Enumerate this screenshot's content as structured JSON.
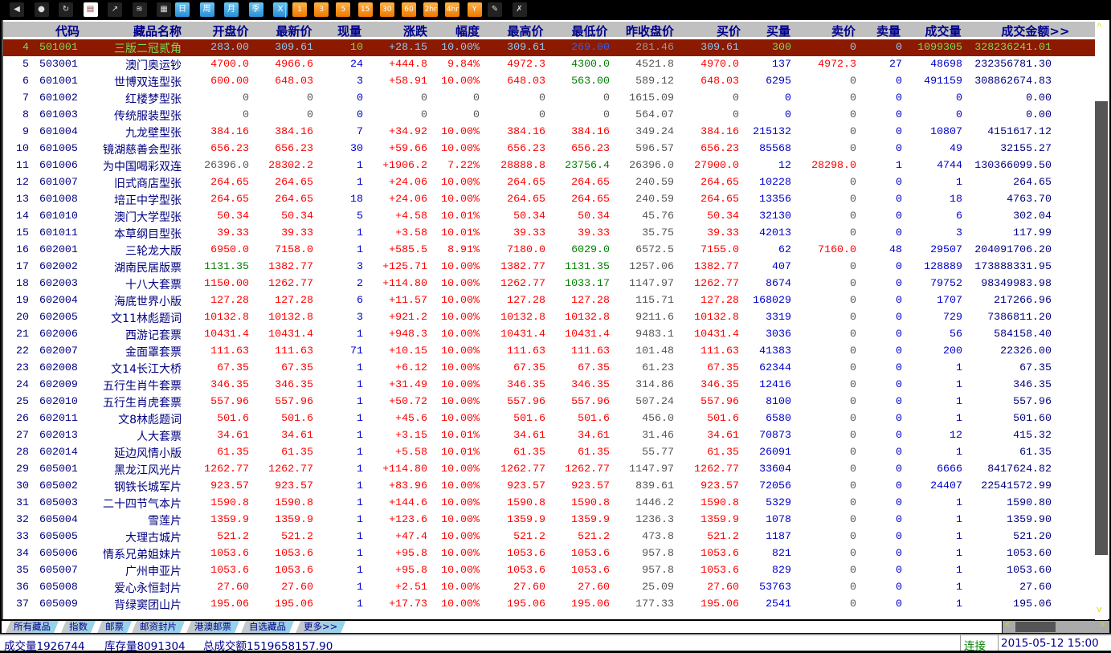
{
  "toolbar": {
    "icons": [
      "back-icon",
      "home-icon",
      "refresh-icon",
      "clipboard-icon",
      "trend-chart-icon",
      "multi-chart-icon",
      "table-icon"
    ],
    "period_buttons": [
      "日",
      "周",
      "月",
      "季",
      "X"
    ],
    "minute_buttons": [
      "1",
      "3",
      "5",
      "15",
      "30",
      "60",
      "2hr",
      "4hr",
      "Y"
    ],
    "tools": [
      "edit-icon",
      "draw-tools-icon"
    ]
  },
  "table": {
    "headers": [
      "代码",
      "藏品名称",
      "开盘价",
      "最新价",
      "现量",
      "涨跌",
      "幅度",
      "最高价",
      "最低价",
      "昨收盘价",
      "买价",
      "买量",
      "卖价",
      "卖量",
      "成交量",
      "成交金额>>"
    ],
    "selected_row": 0,
    "rows": [
      [
        "4",
        "501001",
        "三版二冠贰角",
        "283.00",
        "309.61",
        "10",
        "+28.15",
        "10.00%",
        "309.61",
        "269.00",
        "281.46",
        "309.61",
        "300",
        "0",
        "0",
        "1099305",
        "328236241.01"
      ],
      [
        "5",
        "503001",
        "澳门奥运钞",
        "4700.0",
        "4966.6",
        "24",
        "+444.8",
        "9.84%",
        "4972.3",
        "4300.0",
        "4521.8",
        "4970.0",
        "137",
        "4972.3",
        "27",
        "48698",
        "232356781.30"
      ],
      [
        "6",
        "601001",
        "世博双连型张",
        "600.00",
        "648.03",
        "3",
        "+58.91",
        "10.00%",
        "648.03",
        "563.00",
        "589.12",
        "648.03",
        "6295",
        "0",
        "0",
        "491159",
        "308862674.83"
      ],
      [
        "7",
        "601002",
        "红楼梦型张",
        "0",
        "0",
        "0",
        "0",
        "0",
        "0",
        "0",
        "1615.09",
        "0",
        "0",
        "0",
        "0",
        "0",
        "0.00"
      ],
      [
        "8",
        "601003",
        "传统服装型张",
        "0",
        "0",
        "0",
        "0",
        "0",
        "0",
        "0",
        "564.07",
        "0",
        "0",
        "0",
        "0",
        "0",
        "0.00"
      ],
      [
        "9",
        "601004",
        "九龙壁型张",
        "384.16",
        "384.16",
        "7",
        "+34.92",
        "10.00%",
        "384.16",
        "384.16",
        "349.24",
        "384.16",
        "215132",
        "0",
        "0",
        "10807",
        "4151617.12"
      ],
      [
        "10",
        "601005",
        "镜湖慈善会型张",
        "656.23",
        "656.23",
        "30",
        "+59.66",
        "10.00%",
        "656.23",
        "656.23",
        "596.57",
        "656.23",
        "85568",
        "0",
        "0",
        "49",
        "32155.27"
      ],
      [
        "11",
        "601006",
        "为中国喝彩双连",
        "26396.0",
        "28302.2",
        "1",
        "+1906.2",
        "7.22%",
        "28888.8",
        "23756.4",
        "26396.0",
        "27900.0",
        "12",
        "28298.0",
        "1",
        "4744",
        "130366099.50"
      ],
      [
        "12",
        "601007",
        "旧式商店型张",
        "264.65",
        "264.65",
        "1",
        "+24.06",
        "10.00%",
        "264.65",
        "264.65",
        "240.59",
        "264.65",
        "10228",
        "0",
        "0",
        "1",
        "264.65"
      ],
      [
        "13",
        "601008",
        "培正中学型张",
        "264.65",
        "264.65",
        "18",
        "+24.06",
        "10.00%",
        "264.65",
        "264.65",
        "240.59",
        "264.65",
        "13356",
        "0",
        "0",
        "18",
        "4763.70"
      ],
      [
        "14",
        "601010",
        "澳门大学型张",
        "50.34",
        "50.34",
        "5",
        "+4.58",
        "10.01%",
        "50.34",
        "50.34",
        "45.76",
        "50.34",
        "32130",
        "0",
        "0",
        "6",
        "302.04"
      ],
      [
        "15",
        "601011",
        "本草纲目型张",
        "39.33",
        "39.33",
        "1",
        "+3.58",
        "10.01%",
        "39.33",
        "39.33",
        "35.75",
        "39.33",
        "42013",
        "0",
        "0",
        "3",
        "117.99"
      ],
      [
        "16",
        "602001",
        "三轮龙大版",
        "6950.0",
        "7158.0",
        "1",
        "+585.5",
        "8.91%",
        "7180.0",
        "6029.0",
        "6572.5",
        "7155.0",
        "62",
        "7160.0",
        "48",
        "29507",
        "204091706.20"
      ],
      [
        "17",
        "602002",
        "湖南民居版票",
        "1131.35",
        "1382.77",
        "3",
        "+125.71",
        "10.00%",
        "1382.77",
        "1131.35",
        "1257.06",
        "1382.77",
        "407",
        "0",
        "0",
        "128889",
        "173888331.95"
      ],
      [
        "18",
        "602003",
        "十八大套票",
        "1150.00",
        "1262.77",
        "2",
        "+114.80",
        "10.00%",
        "1262.77",
        "1033.17",
        "1147.97",
        "1262.77",
        "8674",
        "0",
        "0",
        "79752",
        "98349983.98"
      ],
      [
        "19",
        "602004",
        "海底世界小版",
        "127.28",
        "127.28",
        "6",
        "+11.57",
        "10.00%",
        "127.28",
        "127.28",
        "115.71",
        "127.28",
        "168029",
        "0",
        "0",
        "1707",
        "217266.96"
      ],
      [
        "20",
        "602005",
        "文11林彪题词",
        "10132.8",
        "10132.8",
        "3",
        "+921.2",
        "10.00%",
        "10132.8",
        "10132.8",
        "9211.6",
        "10132.8",
        "3319",
        "0",
        "0",
        "729",
        "7386811.20"
      ],
      [
        "21",
        "602006",
        "西游记套票",
        "10431.4",
        "10431.4",
        "1",
        "+948.3",
        "10.00%",
        "10431.4",
        "10431.4",
        "9483.1",
        "10431.4",
        "3036",
        "0",
        "0",
        "56",
        "584158.40"
      ],
      [
        "22",
        "602007",
        "金面罩套票",
        "111.63",
        "111.63",
        "71",
        "+10.15",
        "10.00%",
        "111.63",
        "111.63",
        "101.48",
        "111.63",
        "41383",
        "0",
        "0",
        "200",
        "22326.00"
      ],
      [
        "23",
        "602008",
        "文14长江大桥",
        "67.35",
        "67.35",
        "1",
        "+6.12",
        "10.00%",
        "67.35",
        "67.35",
        "61.23",
        "67.35",
        "62344",
        "0",
        "0",
        "1",
        "67.35"
      ],
      [
        "24",
        "602009",
        "五行生肖牛套票",
        "346.35",
        "346.35",
        "1",
        "+31.49",
        "10.00%",
        "346.35",
        "346.35",
        "314.86",
        "346.35",
        "12416",
        "0",
        "0",
        "1",
        "346.35"
      ],
      [
        "25",
        "602010",
        "五行生肖虎套票",
        "557.96",
        "557.96",
        "1",
        "+50.72",
        "10.00%",
        "557.96",
        "557.96",
        "507.24",
        "557.96",
        "8100",
        "0",
        "0",
        "1",
        "557.96"
      ],
      [
        "26",
        "602011",
        "文8林彪题词",
        "501.6",
        "501.6",
        "1",
        "+45.6",
        "10.00%",
        "501.6",
        "501.6",
        "456.0",
        "501.6",
        "6580",
        "0",
        "0",
        "1",
        "501.60"
      ],
      [
        "27",
        "602013",
        "人大套票",
        "34.61",
        "34.61",
        "1",
        "+3.15",
        "10.01%",
        "34.61",
        "34.61",
        "31.46",
        "34.61",
        "70873",
        "0",
        "0",
        "12",
        "415.32"
      ],
      [
        "28",
        "602014",
        "延边风情小版",
        "61.35",
        "61.35",
        "1",
        "+5.58",
        "10.01%",
        "61.35",
        "61.35",
        "55.77",
        "61.35",
        "26091",
        "0",
        "0",
        "1",
        "61.35"
      ],
      [
        "29",
        "605001",
        "黑龙江风光片",
        "1262.77",
        "1262.77",
        "1",
        "+114.80",
        "10.00%",
        "1262.77",
        "1262.77",
        "1147.97",
        "1262.77",
        "33604",
        "0",
        "0",
        "6666",
        "8417624.82"
      ],
      [
        "30",
        "605002",
        "钢铁长城军片",
        "923.57",
        "923.57",
        "1",
        "+83.96",
        "10.00%",
        "923.57",
        "923.57",
        "839.61",
        "923.57",
        "72056",
        "0",
        "0",
        "24407",
        "22541572.99"
      ],
      [
        "31",
        "605003",
        "二十四节气本片",
        "1590.8",
        "1590.8",
        "1",
        "+144.6",
        "10.00%",
        "1590.8",
        "1590.8",
        "1446.2",
        "1590.8",
        "5329",
        "0",
        "0",
        "1",
        "1590.80"
      ],
      [
        "32",
        "605004",
        "雪莲片",
        "1359.9",
        "1359.9",
        "1",
        "+123.6",
        "10.00%",
        "1359.9",
        "1359.9",
        "1236.3",
        "1359.9",
        "1078",
        "0",
        "0",
        "1",
        "1359.90"
      ],
      [
        "33",
        "605005",
        "大理古城片",
        "521.2",
        "521.2",
        "1",
        "+47.4",
        "10.00%",
        "521.2",
        "521.2",
        "473.8",
        "521.2",
        "1187",
        "0",
        "0",
        "1",
        "521.20"
      ],
      [
        "34",
        "605006",
        "情系兄弟姐妹片",
        "1053.6",
        "1053.6",
        "1",
        "+95.8",
        "10.00%",
        "1053.6",
        "1053.6",
        "957.8",
        "1053.6",
        "821",
        "0",
        "0",
        "1",
        "1053.60"
      ],
      [
        "35",
        "605007",
        "广州申亚片",
        "1053.6",
        "1053.6",
        "1",
        "+95.8",
        "10.00%",
        "1053.6",
        "1053.6",
        "957.8",
        "1053.6",
        "829",
        "0",
        "0",
        "1",
        "1053.60"
      ],
      [
        "36",
        "605008",
        "爱心永恒封片",
        "27.60",
        "27.60",
        "1",
        "+2.51",
        "10.00%",
        "27.60",
        "27.60",
        "25.09",
        "27.60",
        "53763",
        "0",
        "0",
        "1",
        "27.60"
      ],
      [
        "37",
        "605009",
        "背绿窦团山片",
        "195.06",
        "195.06",
        "1",
        "+17.73",
        "10.00%",
        "195.06",
        "195.06",
        "177.33",
        "195.06",
        "2541",
        "0",
        "0",
        "1",
        "195.06"
      ]
    ]
  },
  "tabs": [
    "所有藏品",
    "指数",
    "邮票",
    "邮资封片",
    "港澳邮票",
    "自选藏品",
    "更多>>"
  ],
  "status": {
    "volume": "成交量1926744",
    "stock": "库存量8091304",
    "amount": "总成交额1519658157.90",
    "connection": "连接",
    "datetime": "2015-05-12 15:00"
  },
  "colors": {
    "up": "#ff0000",
    "down": "#008000",
    "flat": "#555555",
    "volume": "#0000cc",
    "amount": "#000080",
    "selected_bg": "#8b1a00",
    "header_bg": "#c0c0c0"
  }
}
